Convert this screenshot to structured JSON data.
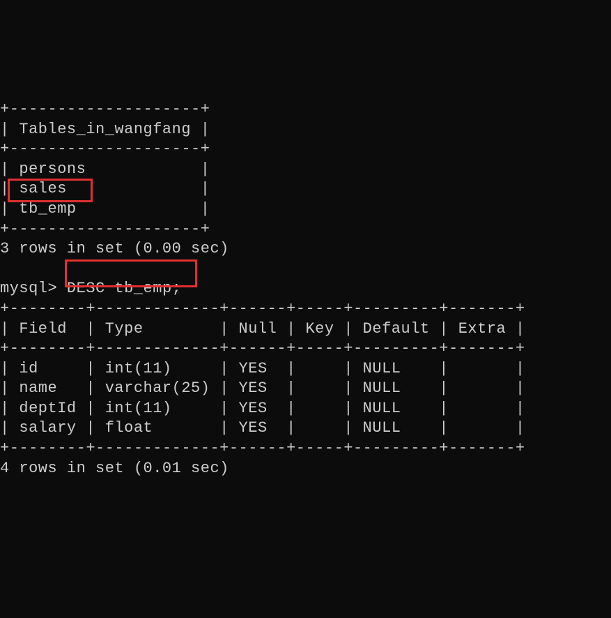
{
  "tables": {
    "border_top": "+--------------------+",
    "header": "| Tables_in_wangfang |",
    "border_mid": "+--------------------+",
    "rows": [
      "| persons            |",
      "| sales              |",
      "| tb_emp             |"
    ],
    "border_bot": "+--------------------+",
    "status": "3 rows in set (0.00 sec)"
  },
  "prompt": {
    "prefix": "mysql> ",
    "command": "DESC tb_emp;"
  },
  "desc": {
    "border_top": "+--------+-------------+------+-----+---------+-------+",
    "header": "| Field  | Type        | Null | Key | Default | Extra |",
    "border_mid": "+--------+-------------+------+-----+---------+-------+",
    "rows": [
      "| id     | int(11)     | YES  |     | NULL    |       |",
      "| name   | varchar(25) | YES  |     | NULL    |       |",
      "| deptId | int(11)     | YES  |     | NULL    |       |",
      "| salary | float       | YES  |     | NULL    |       |"
    ],
    "border_bot": "+--------+-------------+------+-----+---------+-------+",
    "status": "4 rows in set (0.01 sec)"
  }
}
